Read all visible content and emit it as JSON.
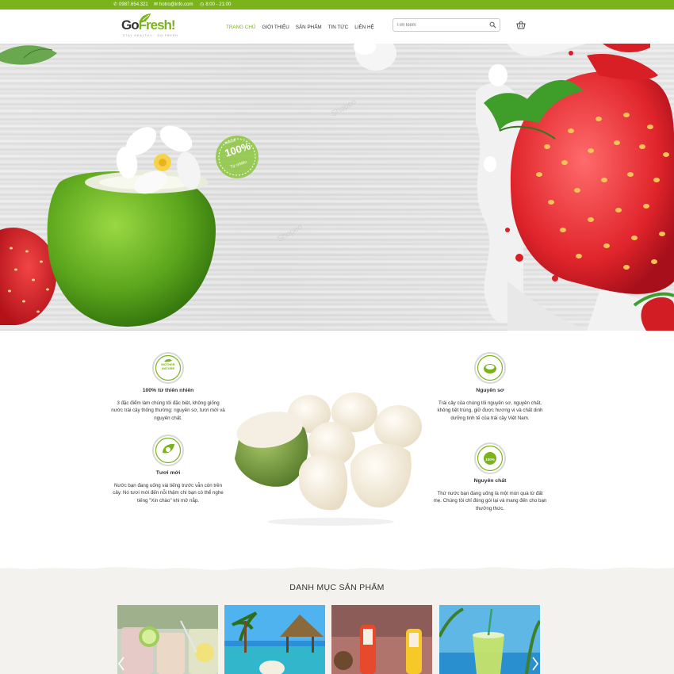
{
  "topbar": {
    "phone": "0987.654.321",
    "email": "hotro@info.com",
    "hours": "8:00 - 21:00"
  },
  "brand": {
    "name_left": "Go",
    "name_right": "Fresh!",
    "tagline": "STAY HEALTHY · GO FRESH",
    "accent": "#7bb31a"
  },
  "nav": {
    "items": [
      {
        "label": "Trang chủ",
        "active": true
      },
      {
        "label": "Giới thiệu"
      },
      {
        "label": "Sản phẩm"
      },
      {
        "label": "Tin tức"
      },
      {
        "label": "Liên hệ"
      }
    ]
  },
  "search": {
    "placeholder": "Tìm kiếm"
  },
  "hero": {
    "badge_top": "Natural",
    "badge_big": "100%",
    "badge_bottom": "Tự nhiên"
  },
  "features": [
    {
      "badge": "MOTHER NATURE",
      "title": "100% từ thiên nhiên",
      "text": "3 đặc điểm làm chúng tôi đặc biệt, không giống nước trái cây thông thường: nguyên sơ, tươi mới và nguyên chất."
    },
    {
      "title": "Tươi mới",
      "text": "Nước bạn đang uống vài tiếng trước vẫn còn trên cây. Nó tươi mới đến nỗi thậm chí bạn có thể nghe tiếng \"Xin chào\" khi mở nắp."
    },
    {
      "title": "Nguyên sơ",
      "text": "Trái cây của chúng tôi nguyên sơ, nguyên chất, không tiệt trùng, giữ được hương vị và chất dinh dưỡng tinh tế của trái cây Việt Nam."
    },
    {
      "badge": "100%",
      "title": "Nguyên chất",
      "text": "Thứ nước bạn đang uống là một món quà từ đất mẹ. Chúng tôi chỉ đóng gói lại và mang đến cho bạn thưởng thức."
    }
  ],
  "categories": {
    "title": "DANH MỤC SẢN PHẨM"
  }
}
